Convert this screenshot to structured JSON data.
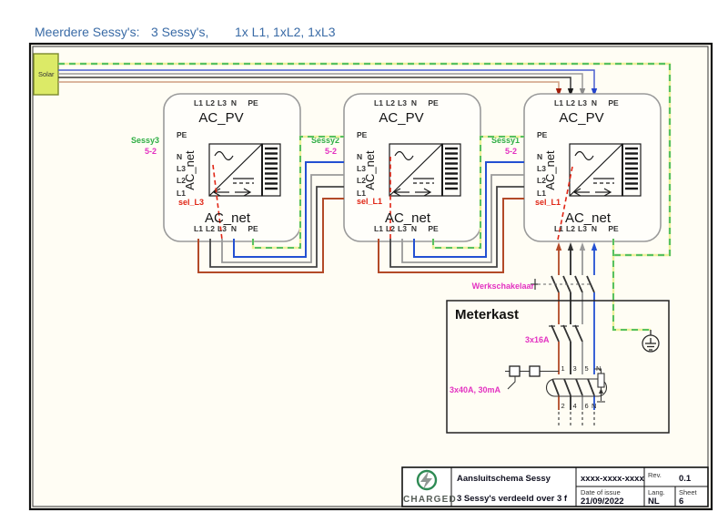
{
  "header": {
    "prefix": "Meerdere Sessy's:",
    "count": "3 Sessy's,",
    "phases": "1x L1, 1xL2, 1xL3"
  },
  "solar": {
    "label": "Solar"
  },
  "labels": {
    "ac_pv": "AC_PV",
    "ac_net": "AC_net"
  },
  "terminals": {
    "top": [
      "L1",
      "L2",
      "L3",
      "N",
      "PE"
    ],
    "left": [
      "PE",
      "N",
      "L3",
      "L2",
      "L1"
    ]
  },
  "units": [
    {
      "name": "Sessy3",
      "code": "5-2",
      "sel": "sel_L3"
    },
    {
      "name": "Sessy2",
      "code": "5-2",
      "sel": "sel_L1"
    },
    {
      "name": "Sessy1",
      "code": "5-2",
      "sel": "sel_L1"
    }
  ],
  "meterkast": {
    "title": "Meterkast",
    "werkschakelaar": "Werkschakelaar",
    "breaker": "3x16A",
    "rcd": "3x40A, 30mA",
    "rcd_top": [
      "1",
      "3",
      "5",
      "N"
    ],
    "rcd_bottom": [
      "2",
      "4",
      "6",
      "N"
    ]
  },
  "title_block": {
    "brand": "CHARGED",
    "doc_title": "Aansluitschema Sessy",
    "doc_subtitle": "3 Sessy's verdeeld over 3 f",
    "doc_number": "xxxx-xxxx-xxxx",
    "rev_label": "Rev.",
    "rev_value": "0.1",
    "date_label": "Date of issue",
    "date_value": "21/09/2022",
    "lang_label": "Lang.",
    "lang_value": "NL",
    "sheet_label": "Sheet",
    "sheet_value": "6"
  },
  "colors": {
    "header_blue": "#3a6ba6",
    "wire_l1": "#b34a28",
    "wire_l2": "#2a2a2a",
    "wire_l3": "#999999",
    "wire_n": "#2350d2",
    "wire_pe_green": "#57c161",
    "wire_pe_yellow": "#eef09a",
    "select_red": "#e02515",
    "magenta": "#e331c1",
    "sessy_green": "#2fae44",
    "solar_fill": "#dcea67"
  }
}
